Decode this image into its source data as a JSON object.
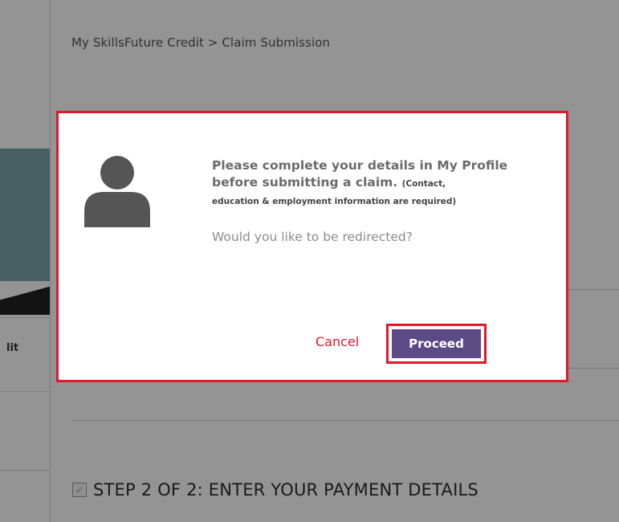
{
  "breadcrumb": "My SkillsFuture Credit > Claim Submission",
  "sidebar": {
    "item_label": "lit"
  },
  "step": {
    "heading": "STEP 2 OF 2: ENTER YOUR PAYMENT DETAILS",
    "check_icon": "check-icon"
  },
  "dialog": {
    "avatar_icon": "user-avatar-icon",
    "message_main": "Please complete your details in My Profile before submitting a claim.",
    "message_note": "(Contact, education & employment information are required)",
    "question": "Would you like to be redirected?",
    "cancel_label": "Cancel",
    "proceed_label": "Proceed"
  },
  "colors": {
    "highlight_border": "#e0192b",
    "proceed_button": "#5b4a86",
    "cancel_text": "#e0192b"
  }
}
